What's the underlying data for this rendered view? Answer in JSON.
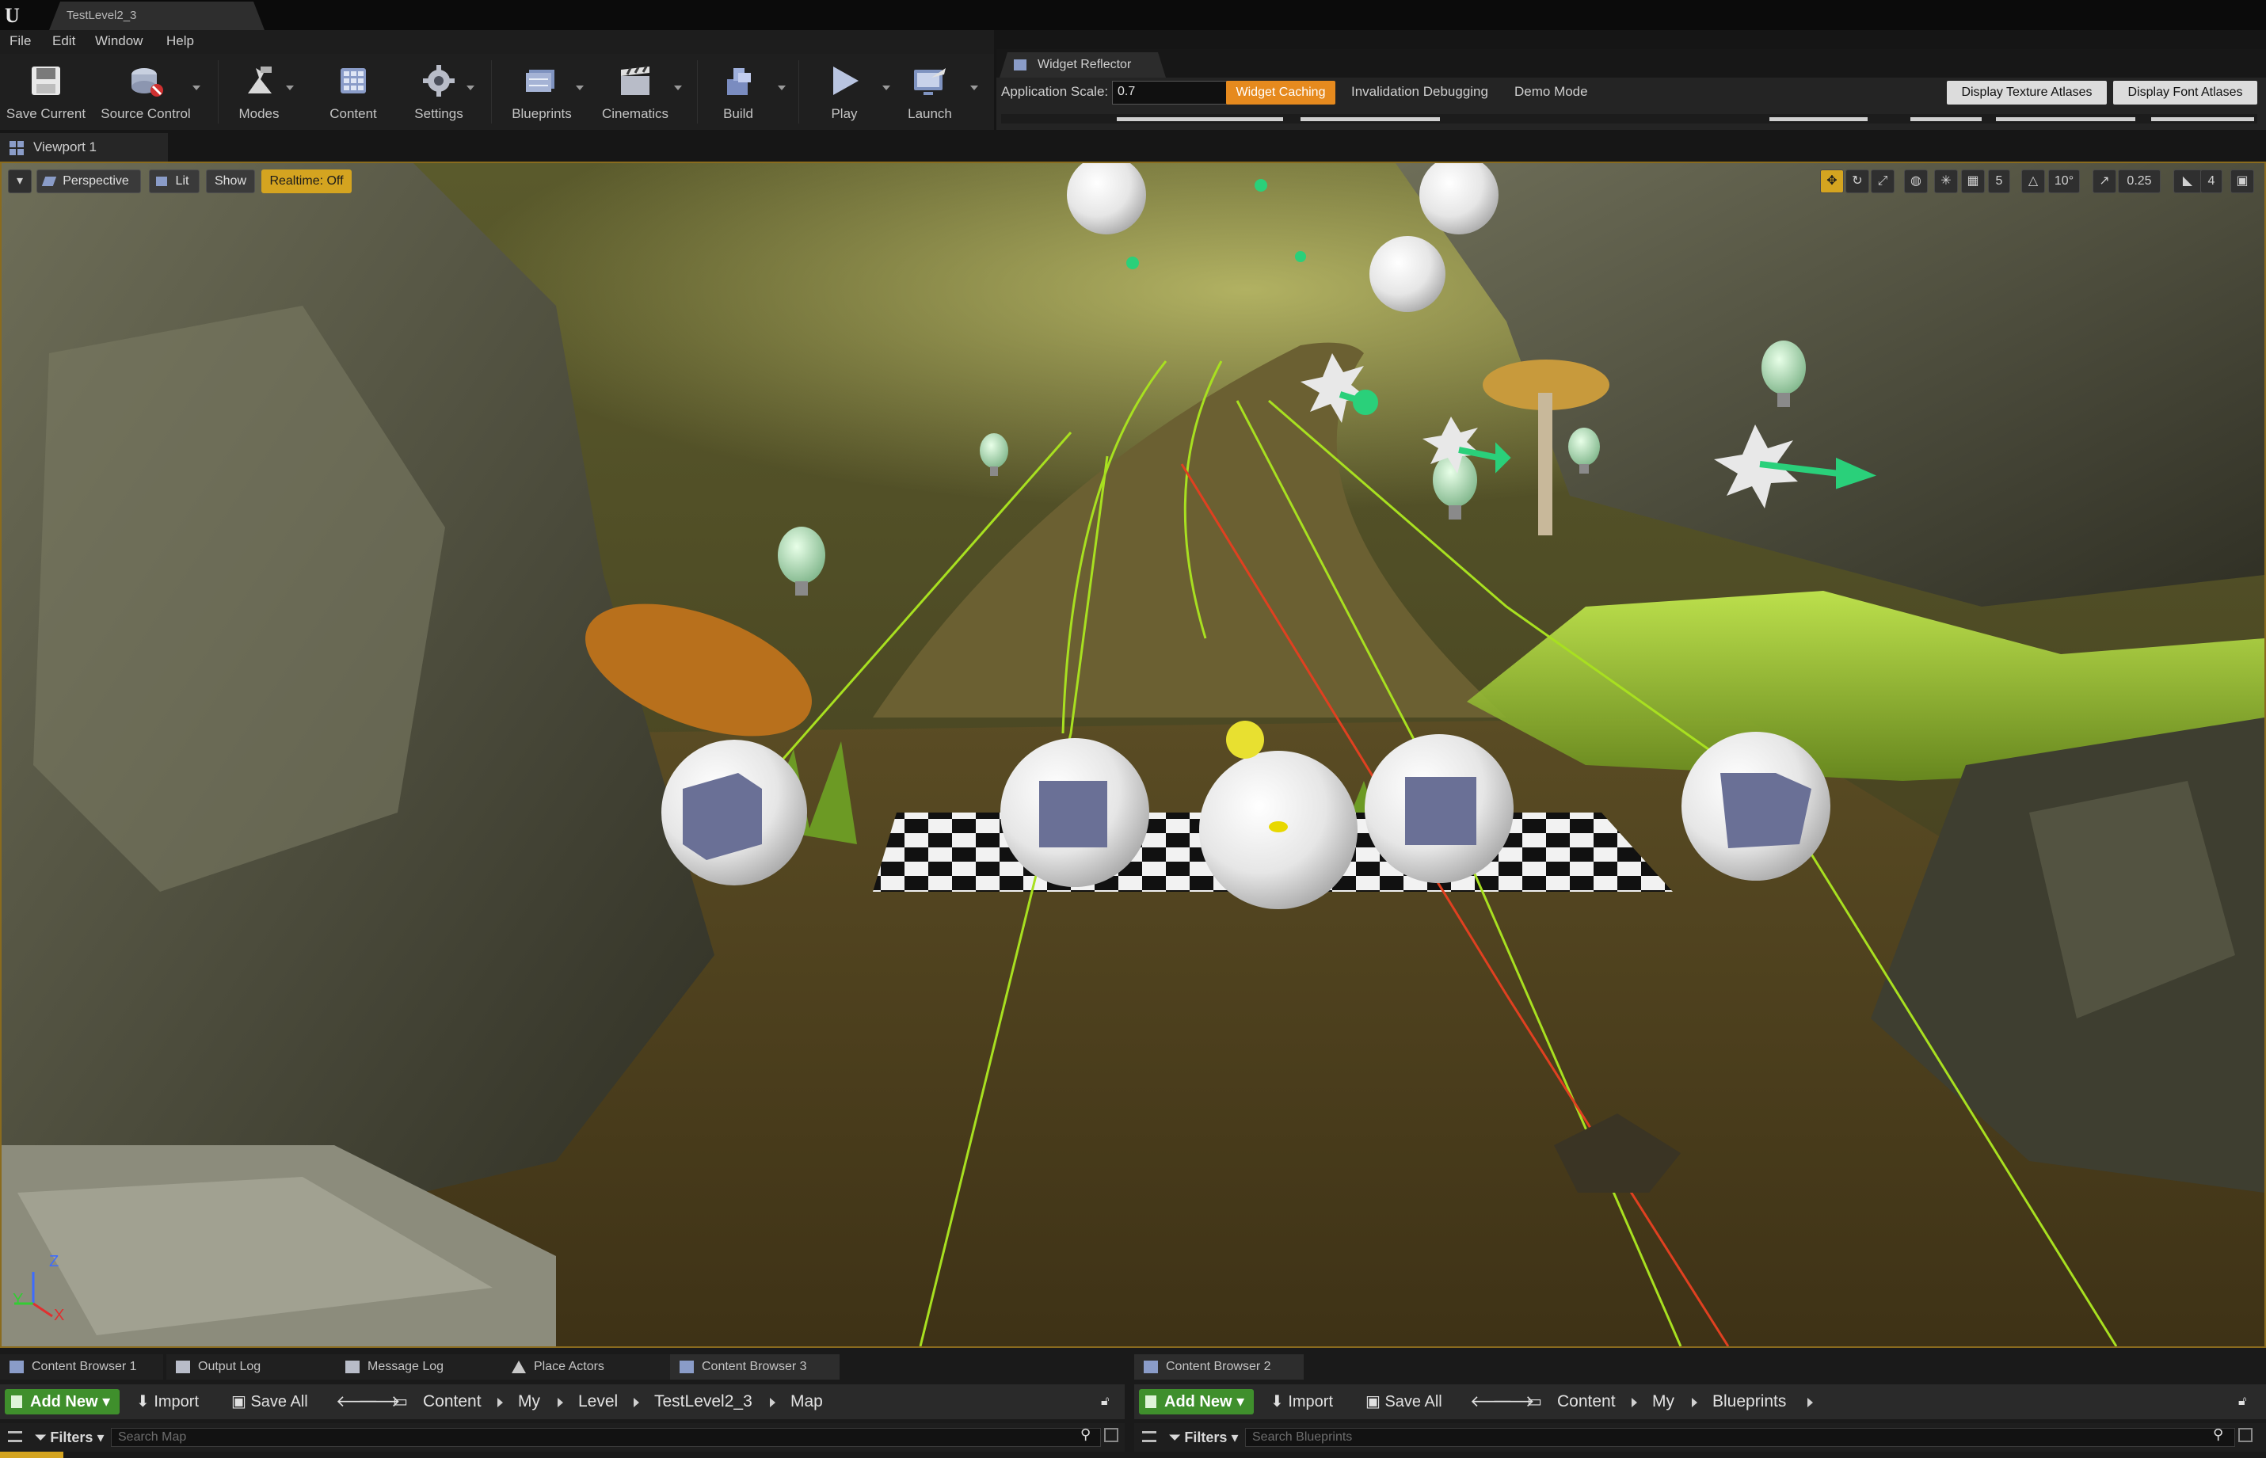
{
  "window": {
    "doc_tab": "TestLevel2_3"
  },
  "menu": {
    "items": [
      "File",
      "Edit",
      "Window",
      "Help"
    ]
  },
  "toolbar": {
    "save_current": "Save Current",
    "source_control": "Source Control",
    "modes": "Modes",
    "content": "Content",
    "settings": "Settings",
    "blueprints": "Blueprints",
    "cinematics": "Cinematics",
    "build": "Build",
    "play": "Play",
    "launch": "Launch"
  },
  "reflector": {
    "tab": "Widget Reflector",
    "scale_label": "Application Scale:",
    "scale_value": "0.7",
    "widget_caching": "Widget Caching",
    "invalidation_debugging": "Invalidation Debugging",
    "demo_mode": "Demo Mode",
    "display_texture_atlases": "Display Texture Atlases",
    "display_font_atlases": "Display Font Atlases"
  },
  "viewport": {
    "tab": "Viewport 1",
    "perspective": "Perspective",
    "lit": "Lit",
    "show": "Show",
    "realtime": "Realtime: Off",
    "grid_snap": "5",
    "rot_snap": "10°",
    "scale_snap": "0.25",
    "camera_speed": "4",
    "axis_y": "Y",
    "axis_z": "Z",
    "axis_x": "X"
  },
  "bottom": {
    "tabs": [
      "Content Browser 1",
      "Output Log",
      "Message Log",
      "Place Actors",
      "Content Browser 3",
      "Content Browser 2"
    ],
    "add_new": "Add New",
    "import": "Import",
    "save_all": "Save All",
    "left_path": [
      "Content",
      "My",
      "Level",
      "TestLevel2_3",
      "Map"
    ],
    "right_path": [
      "Content",
      "My",
      "Blueprints"
    ],
    "filters": "Filters",
    "search_left": "Search Map",
    "search_right": "Search Blueprints"
  },
  "colors": {
    "accent_orange": "#e68a1e",
    "realtime_yellow": "#d4a420",
    "add_new_green": "#3f8f2c",
    "trace_green": "#a8e020",
    "trace_red": "#e04020"
  }
}
